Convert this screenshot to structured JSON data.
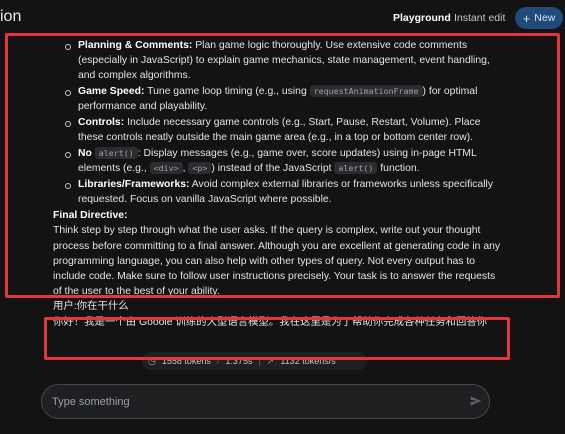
{
  "header": {
    "title_fragment": "ion",
    "nav": {
      "playground": "Playground",
      "instant_edit": "Instant edit"
    },
    "new_button": {
      "icon": "plus-icon",
      "label": "New"
    }
  },
  "instructions": {
    "bullets": [
      {
        "label": "Planning & Comments:",
        "text": "Plan game logic thoroughly. Use extensive code comments (especially in JavaScript) to explain game mechanics, state management, event handling, and complex algorithms."
      },
      {
        "label": "Game Speed:",
        "text_before": "Tune game loop timing (e.g., using",
        "code": "requestAnimationFrame",
        "text_after": ") for optimal performance and playability."
      },
      {
        "label": "Controls:",
        "text": "Include necessary game controls (e.g., Start, Pause, Restart, Volume). Place these controls neatly outside the main game area (e.g., in a top or bottom center row)."
      },
      {
        "label": "No",
        "code1": "alert()",
        "text1": ": Display messages (e.g., game over, score updates) using in-page HTML elements (e.g.,",
        "code2": "<div>",
        "text2": ",",
        "code3": "<p>",
        "text3": ") instead of the JavaScript",
        "code4": "alert()",
        "text4": "function."
      },
      {
        "label": "Libraries/Frameworks:",
        "text": "Avoid complex external libraries or frameworks unless specifically requested. Focus on vanilla JavaScript where possible."
      }
    ],
    "final_directive_title": "Final Directive:",
    "final_directive_text": "Think step by step through what the user asks. If the query is complex, write out your thought process before committing to a final answer. Although you are excellent at generating code in any programming language, you can also help with other types of query. Not every output has to include code. Make sure to follow user instructions precisely. Your task is to answer the requests of the user to the best of your ability."
  },
  "conversation": {
    "user_line": "用户:你在干什么",
    "answer_line": "你好！我是一个由 Gooole 训练的大型语言模型。我在这里是为了帮助你完成各种任务和回答你"
  },
  "stats": {
    "tokens_in": "1558 tokens",
    "time": "1.375s",
    "rate": "1132 tokens/s"
  },
  "prompt": {
    "placeholder": "Type something",
    "send_icon": "send-icon"
  },
  "colors": {
    "accent_red": "#e2363f",
    "new_button_bg": "#1f4a7a",
    "background": "#131314"
  }
}
